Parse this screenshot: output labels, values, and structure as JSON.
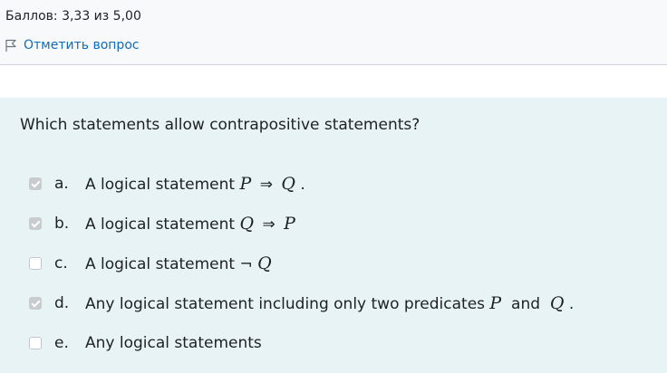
{
  "info": {
    "grade": "Баллов: 3,33 из 5,00",
    "flag_label": "Отметить вопрос"
  },
  "question": {
    "text": "Which statements allow contrapositive statements?",
    "answers": [
      {
        "letter": "a.",
        "checked": true,
        "prefix": "A logical statement ",
        "var1": "P",
        "op": "⇒",
        "var2": "Q",
        "suffix": "."
      },
      {
        "letter": "b.",
        "checked": true,
        "prefix": "A logical statement ",
        "var1": "Q",
        "op": "⇒",
        "var2": "P"
      },
      {
        "letter": "c.",
        "checked": false,
        "prefix": "A logical statement ",
        "neg": "¬",
        "var1": "Q"
      },
      {
        "letter": "d.",
        "checked": true,
        "prefix": "Any logical statement including only two predicates ",
        "var1": "P",
        "mid": " and ",
        "var2": "Q",
        "suffix": "."
      },
      {
        "letter": "e.",
        "checked": false,
        "prefix": "Any logical statements"
      }
    ]
  },
  "colors": {
    "question_bg": "#e7f3f5",
    "info_bg": "#f8f9fa",
    "link": "#0f6cbf",
    "checked_box": "#c8cccf"
  },
  "icons": {
    "flag": "flag-icon"
  }
}
